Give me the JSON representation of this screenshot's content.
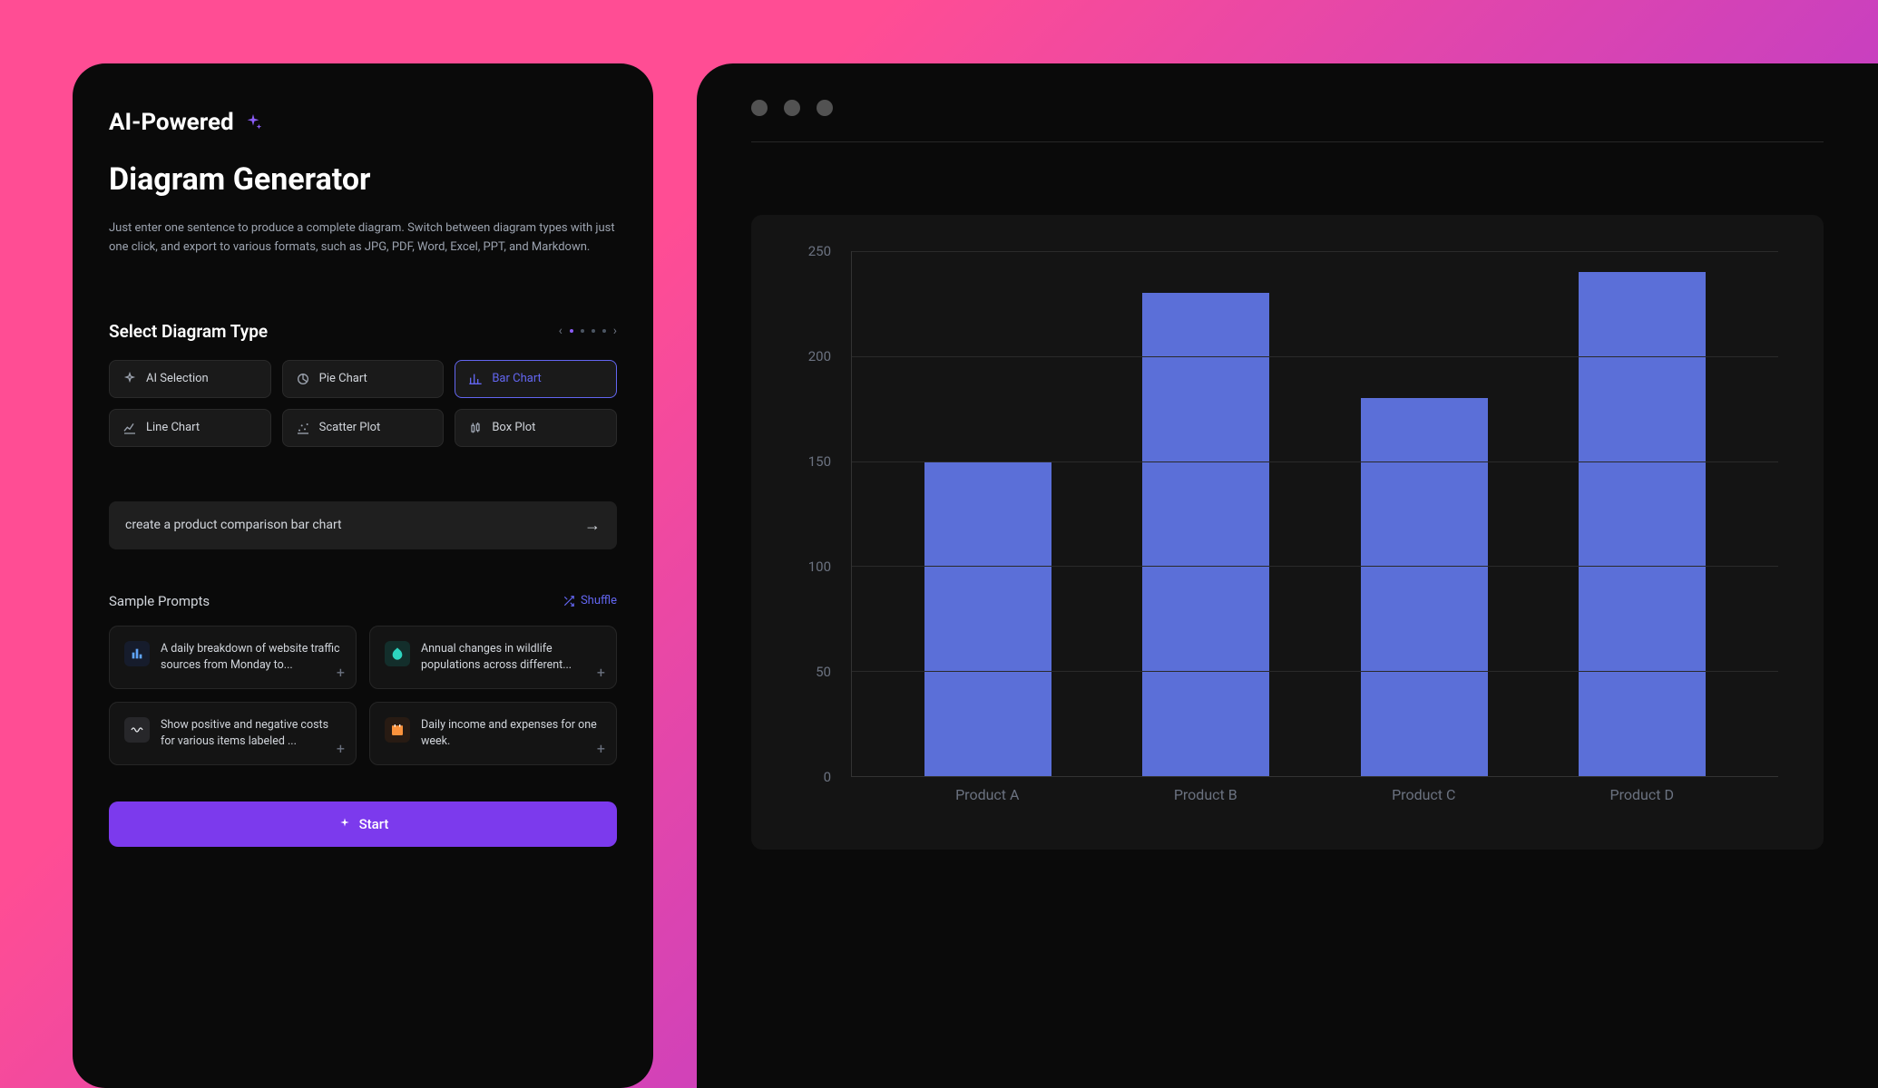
{
  "header": {
    "ai_powered": "AI-Powered",
    "title": "Diagram Generator",
    "description": "Just enter one sentence to produce a complete diagram. Switch between diagram types with just one click, and export to various formats, such as JPG, PDF, Word, Excel, PPT, and Markdown."
  },
  "diagram_type": {
    "label": "Select Diagram Type",
    "options": [
      {
        "label": "AI Selection",
        "icon": "sparkle"
      },
      {
        "label": "Pie Chart",
        "icon": "pie"
      },
      {
        "label": "Bar Chart",
        "icon": "bar",
        "active": true
      },
      {
        "label": "Line Chart",
        "icon": "line"
      },
      {
        "label": "Scatter Plot",
        "icon": "scatter"
      },
      {
        "label": "Box Plot",
        "icon": "box"
      }
    ]
  },
  "prompt": {
    "text": "create a product comparison bar chart"
  },
  "samples": {
    "label": "Sample Prompts",
    "shuffle_label": "Shuffle",
    "items": [
      {
        "text": "A daily breakdown of website traffic sources from Monday to...",
        "icon": "blue"
      },
      {
        "text": "Annual changes in wildlife populations across different...",
        "icon": "teal"
      },
      {
        "text": "Show positive and negative costs for various items labeled ...",
        "icon": "dark"
      },
      {
        "text": "Daily income and expenses for one week.",
        "icon": "orange"
      }
    ]
  },
  "start_button": "Start",
  "chart_data": {
    "type": "bar",
    "categories": [
      "Product A",
      "Product B",
      "Product C",
      "Product D"
    ],
    "values": [
      150,
      230,
      180,
      240
    ],
    "ylim": [
      0,
      250
    ],
    "yticks": [
      0,
      50,
      100,
      150,
      200,
      250
    ],
    "bar_color": "#5b6fd8"
  }
}
